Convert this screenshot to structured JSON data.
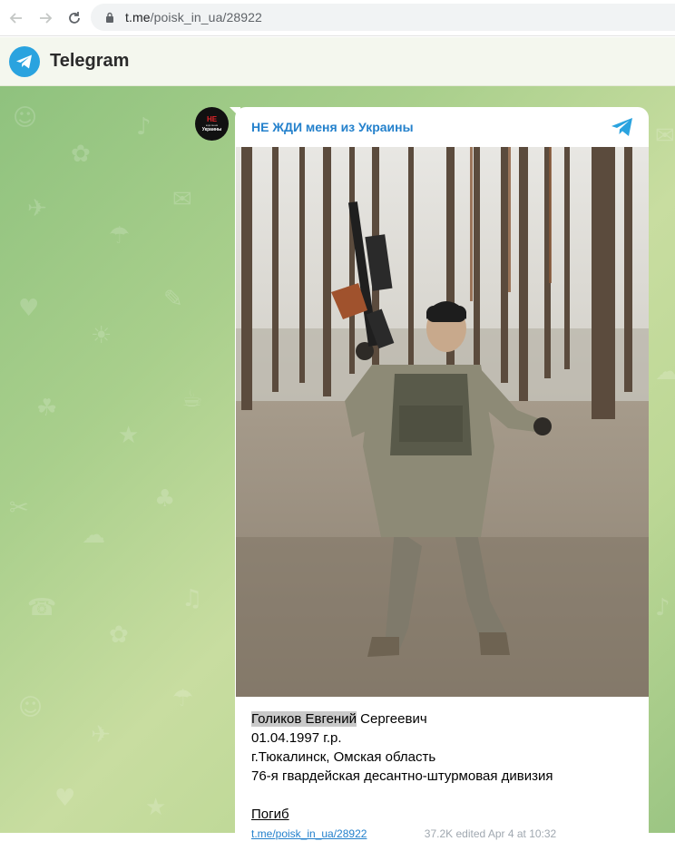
{
  "browser": {
    "url_host": "t.me",
    "url_path": "/poisk_in_ua/28922"
  },
  "header": {
    "title": "Telegram"
  },
  "channel": {
    "name": "НЕ ЖДИ меня из Украины",
    "avatar_top": "НЕ",
    "avatar_mid": "жди меня",
    "avatar_bottom": "Украины"
  },
  "caption": {
    "name_highlight": "Голиков Евгений",
    "name_rest": " Сергеевич",
    "birth": "01.04.1997 г.р.",
    "place": "г.Тюкалинск, Омская область",
    "unit": "76-я гвардейская десантно-штурмовая дивизия",
    "status": "Погиб"
  },
  "footer": {
    "link": "t.me/poisk_in_ua/28922",
    "meta": "37.2K  edited  Apr 4 at 10:32"
  },
  "colors": {
    "accent": "#2481cc",
    "telegram_blue": "#2aa3df"
  }
}
